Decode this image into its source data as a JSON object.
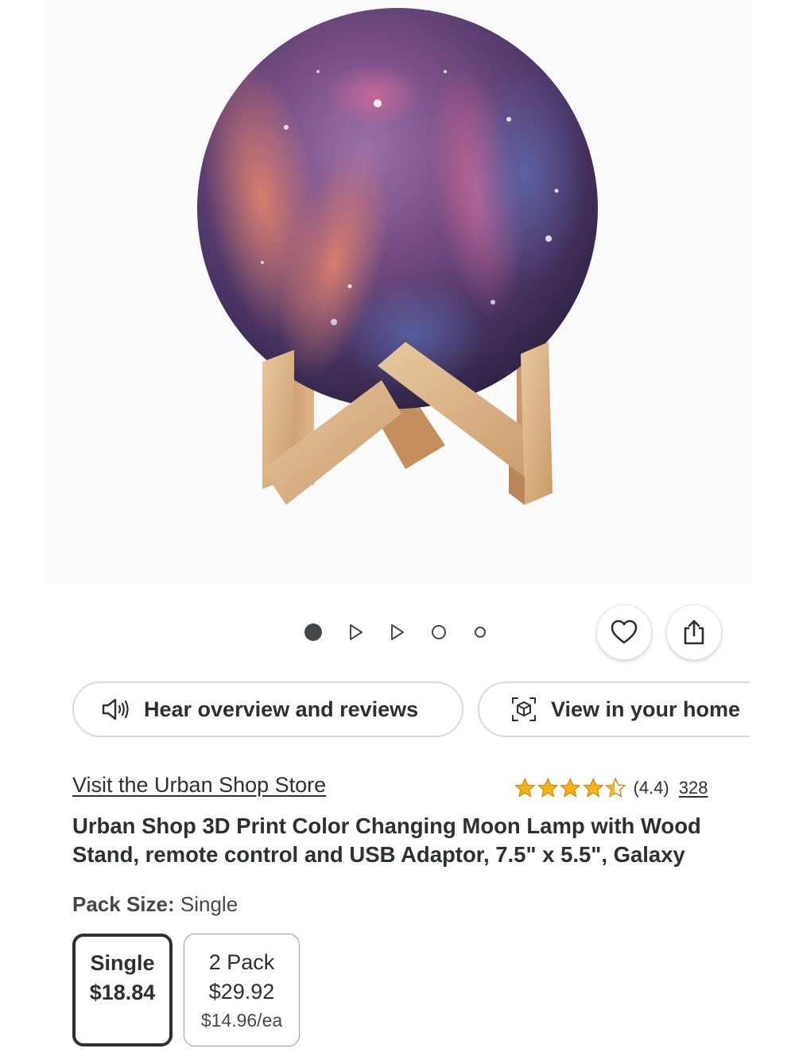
{
  "product_image": {
    "description_icon": "moon-lamp-image"
  },
  "carousel": {
    "items": [
      "image",
      "video",
      "video",
      "3d",
      "more"
    ],
    "active_index": 0
  },
  "actions": {
    "favorite_icon": "heart-icon",
    "share_icon": "share-icon"
  },
  "buttons": {
    "hear_label": "Hear overview and reviews",
    "view_label": "View in your home"
  },
  "store": {
    "link_text": "Visit the Urban Shop Store"
  },
  "rating": {
    "stars": 4.4,
    "value_text": "(4.4)",
    "count": "328",
    "star_color": "#f7b21b"
  },
  "product": {
    "title": "Urban Shop 3D Print Color Changing Moon Lamp with Wood Stand, remote control and USB Adaptor, 7.5\" x 5.5\", Galaxy"
  },
  "pack_size": {
    "label": "Pack Size:",
    "selected": "Single",
    "options": [
      {
        "name": "Single",
        "price": "$18.84",
        "unit_price": ""
      },
      {
        "name": "2 Pack",
        "price": "$29.92",
        "unit_price": "$14.96/ea"
      }
    ]
  }
}
